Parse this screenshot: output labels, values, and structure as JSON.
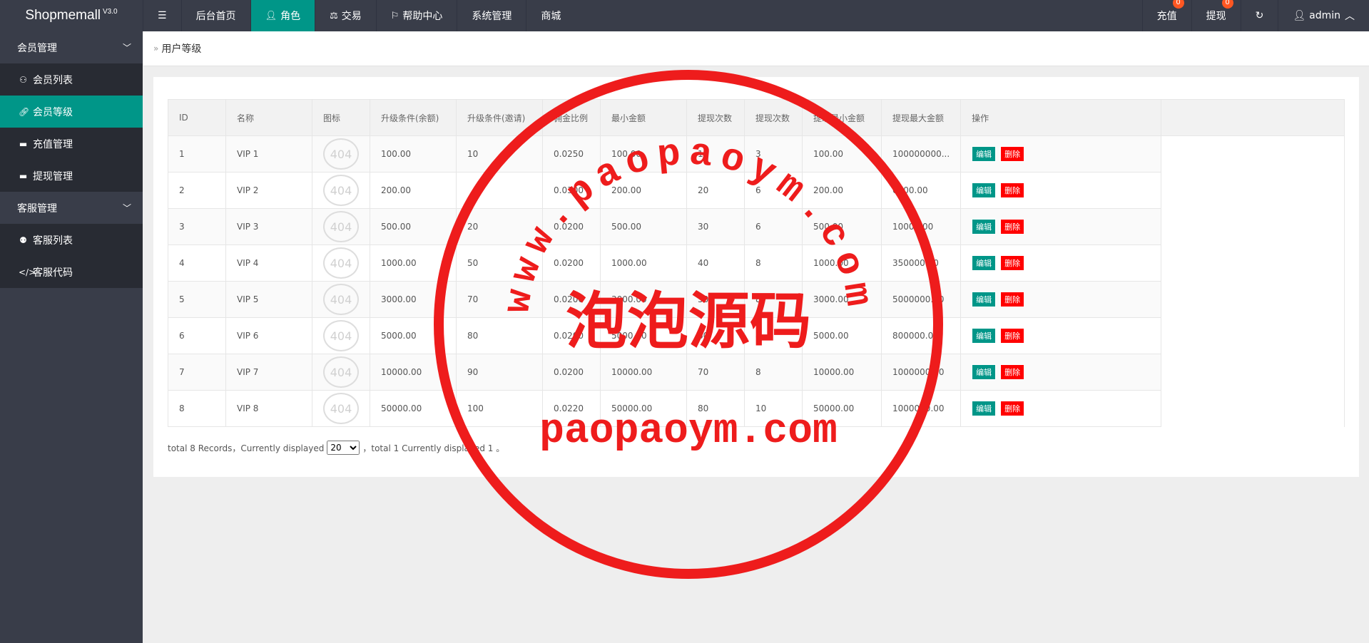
{
  "app": {
    "name": "Shopmemall",
    "version": "V3.0"
  },
  "topnav": {
    "menu_icon": "menu-toggle-icon",
    "items": [
      {
        "label": "后台首页"
      },
      {
        "label": "角色",
        "icon": "user-icon",
        "active": true
      },
      {
        "label": "交易",
        "icon": "scale-icon"
      },
      {
        "label": "帮助中心",
        "icon": "flag-icon"
      },
      {
        "label": "系统管理"
      },
      {
        "label": "商城"
      }
    ],
    "right": {
      "recharge_label": "充值",
      "recharge_badge": "0",
      "withdraw_label": "提现",
      "withdraw_badge": "0",
      "user_label": "admin"
    }
  },
  "sidebar": {
    "groups": [
      {
        "label": "会员管理",
        "items": [
          {
            "label": "会员列表",
            "icon": "user-icon"
          },
          {
            "label": "会员等级",
            "icon": "link-icon",
            "active": true
          },
          {
            "label": "充值管理",
            "icon": "card-icon"
          },
          {
            "label": "提现管理",
            "icon": "card-icon"
          }
        ]
      },
      {
        "label": "客服管理",
        "items": [
          {
            "label": "客服列表",
            "icon": "users-icon"
          },
          {
            "label": "客服代码",
            "icon": "code-icon"
          }
        ]
      }
    ]
  },
  "breadcrumb": {
    "current": "用户等级"
  },
  "table": {
    "headers": [
      "ID",
      "名称",
      "图标",
      "升级条件(余额)",
      "升级条件(邀请)",
      "佣金比例",
      "最小金额",
      "提现次数",
      "提现次数",
      "提现最小金额",
      "提现最大金额",
      "操作"
    ],
    "icon_placeholder": "404",
    "edit_label": "编辑",
    "delete_label": "删除",
    "rows": [
      {
        "id": "1",
        "name": "VIP 1",
        "balance": "100.00",
        "invite": "10",
        "ratio": "0.0250",
        "min": "100.00",
        "c1": "10",
        "c2": "3",
        "wmin": "100.00",
        "wmax": "100000000..."
      },
      {
        "id": "2",
        "name": "VIP 2",
        "balance": "200.00",
        "invite": "",
        "ratio": "0.0300",
        "min": "200.00",
        "c1": "20",
        "c2": "6",
        "wmin": "200.00",
        "wmax": "6000.00"
      },
      {
        "id": "3",
        "name": "VIP 3",
        "balance": "500.00",
        "invite": "20",
        "ratio": "0.0200",
        "min": "500.00",
        "c1": "30",
        "c2": "6",
        "wmin": "500.00",
        "wmax": "10000.00"
      },
      {
        "id": "4",
        "name": "VIP 4",
        "balance": "1000.00",
        "invite": "50",
        "ratio": "0.0200",
        "min": "1000.00",
        "c1": "40",
        "c2": "8",
        "wmin": "1000.00",
        "wmax": "350000.00"
      },
      {
        "id": "5",
        "name": "VIP 5",
        "balance": "3000.00",
        "invite": "70",
        "ratio": "0.0200",
        "min": "3000.00",
        "c1": "50",
        "c2": "8",
        "wmin": "3000.00",
        "wmax": "5000000.00"
      },
      {
        "id": "6",
        "name": "VIP 6",
        "balance": "5000.00",
        "invite": "80",
        "ratio": "0.0200",
        "min": "5000.00",
        "c1": "60",
        "c2": "8",
        "wmin": "5000.00",
        "wmax": "800000.00"
      },
      {
        "id": "7",
        "name": "VIP 7",
        "balance": "10000.00",
        "invite": "90",
        "ratio": "0.0200",
        "min": "10000.00",
        "c1": "70",
        "c2": "8",
        "wmin": "10000.00",
        "wmax": "1000000.00"
      },
      {
        "id": "8",
        "name": "VIP 8",
        "balance": "50000.00",
        "invite": "100",
        "ratio": "0.0220",
        "min": "50000.00",
        "c1": "80",
        "c2": "10",
        "wmin": "50000.00",
        "wmax": "1000000.00"
      }
    ]
  },
  "pager": {
    "prefix": "total 8 Records，Currently displayed",
    "page_size": "20",
    "suffix": "，total 1 Currently displayed 1 。"
  },
  "watermark": {
    "arc_text": "www.paopaoym.com",
    "center_text": "泡泡源码",
    "bottom_text": "paopaoym.com",
    "color": "#ee1c1c"
  }
}
